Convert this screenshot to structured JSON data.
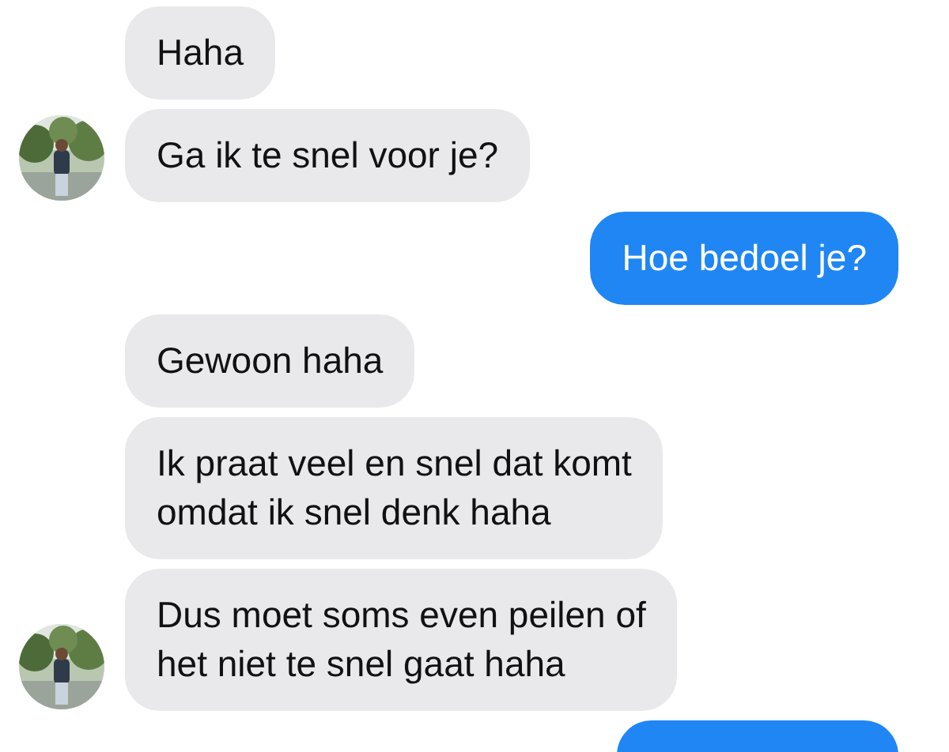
{
  "messages": [
    {
      "kind": "received",
      "avatar": false,
      "lines": [
        "Haha"
      ]
    },
    {
      "kind": "received",
      "avatar": true,
      "lines": [
        "Ga ik te snel voor je?"
      ]
    },
    {
      "kind": "sent",
      "avatar": false,
      "lines": [
        "Hoe bedoel je?"
      ]
    },
    {
      "kind": "received",
      "avatar": false,
      "lines": [
        "Gewoon haha"
      ]
    },
    {
      "kind": "received",
      "avatar": false,
      "lines": [
        "Ik praat veel en snel dat komt",
        "omdat ik snel denk haha"
      ]
    },
    {
      "kind": "received",
      "avatar": true,
      "lines": [
        "Dus moet soms even peilen of",
        "het niet te snel gaat haha"
      ]
    },
    {
      "kind": "sent",
      "avatar": false
    }
  ]
}
